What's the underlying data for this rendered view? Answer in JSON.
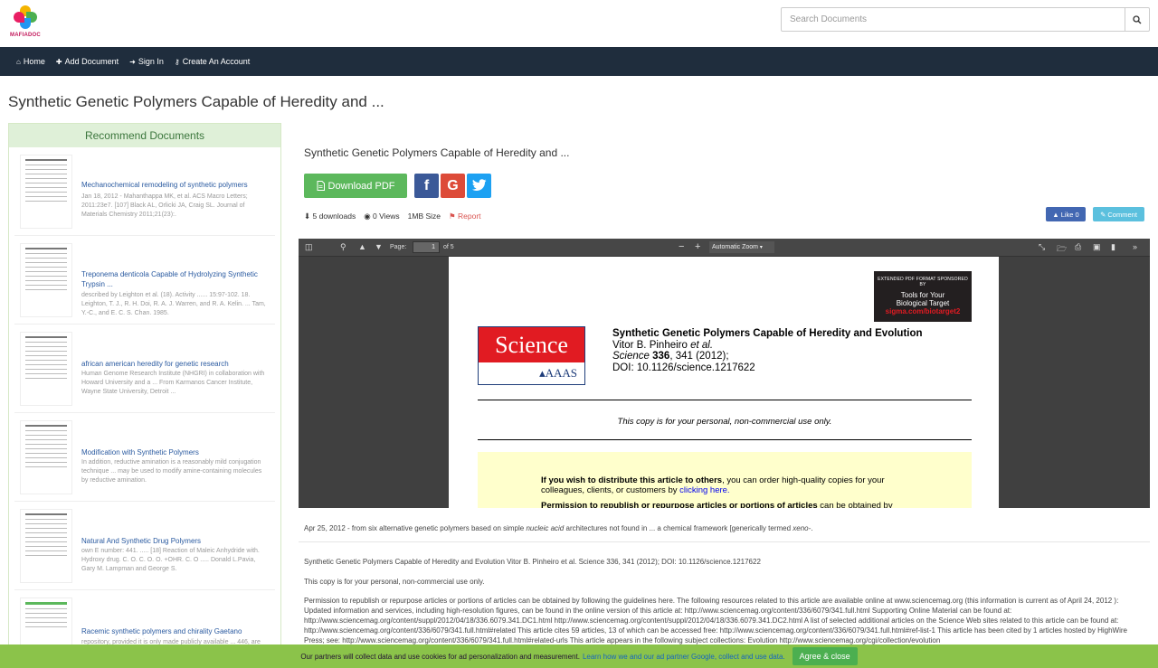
{
  "brand": {
    "name": "MAFIADOC"
  },
  "search": {
    "placeholder": "Search Documents"
  },
  "nav": {
    "items": [
      {
        "label": "Home",
        "icon": "home-icon"
      },
      {
        "label": "Add Document",
        "icon": "plus-icon"
      },
      {
        "label": "Sign In",
        "icon": "sign-in-icon"
      },
      {
        "label": "Create An Account",
        "icon": "key-icon"
      }
    ]
  },
  "page": {
    "title": "Synthetic Genetic Polymers Capable of Heredity and ..."
  },
  "sidebar": {
    "heading": "Recommend Documents",
    "items": [
      {
        "title": "Mechanochemical remodeling of synthetic polymers",
        "desc": "Jan 18, 2012 - Mahanthappa MK, et al. ACS Macro Letters; 2011:23e7. [107] Black AL, Orlicki JA, Craig SL. Journal of Materials Chemistry 2011;21(23):."
      },
      {
        "title": "Treponema denticola Capable of Hydrolyzing Synthetic Trypsin ...",
        "desc": "described by Leighton et al. (18). Activity ...... 15:97-102. 18. Leighton, T. J., R. H. Doi, R. A. J. Warren, and R. A. Kelin. ... Tam, Y.-C., and E. C. S. Chan. 1985."
      },
      {
        "title": "african american heredity for genetic research",
        "desc": "Human Genome Research Institute (NHGRI) in collaboration with Howard University and a ... From Karmanos Cancer Institute, Wayne State University, Detroit ..."
      },
      {
        "title": "Modification with Synthetic Polymers",
        "desc": "In addition, reductive amination is a reasonably mild conjugation technique ... may be used to modify amine-containing molecules by reductive amination."
      },
      {
        "title": "Natural And Synthetic Drug Polymers",
        "desc": "own E number: 441. ..... [18] Reaction of Maleic Anhydride with. Hydroxy drug. C. O. C. O. O. +OHR. C. O ..... Donald L.Pavia, Gary M. Lampman and George S."
      },
      {
        "title": "Racemic synthetic polymers and chirality Gaetano",
        "desc": "repository, provided it is only made publicly available ... 446, are related to possible formation of long ordered ... Of course, these chiral catalysts are ... bidden), which in turn"
      }
    ]
  },
  "document": {
    "title": "Synthetic Genetic Polymers Capable of Heredity and ...",
    "download_label": "Download PDF",
    "downloads": "5 downloads",
    "views": "0 Views",
    "size": "1MB Size",
    "report": "Report",
    "like_label": "Like 0",
    "comment_label": "Comment"
  },
  "viewer": {
    "page_label": "Page:",
    "page_current": "1",
    "page_total": "of 5",
    "zoom": "Automatic Zoom",
    "sponsor_line1": "EXTENDED PDF FORMAT SPONSORED BY",
    "sponsor_line2": "Tools for Your",
    "sponsor_line3": "Biological Target",
    "sponsor_link": "sigma.com/biotarget2",
    "logo_top": "Science",
    "logo_bottom": "AAAS",
    "article_title": "Synthetic Genetic Polymers Capable of Heredity and Evolution",
    "article_authors": "Vitor B. Pinheiro ",
    "article_etal": "et al.",
    "article_journal": "Science",
    "article_vol": " 336",
    "article_pages": ", 341 (2012);",
    "article_doi": "DOI: 10.1126/science.1217622",
    "copy_note": "This copy is for your personal, non-commercial use only.",
    "dist_bold": "If you wish to distribute this article to others",
    "dist_rest": ", you can order high-quality copies for your",
    "dist_line2": "colleagues, clients, or customers by ",
    "dist_link": "clicking here.",
    "perm_bold": "Permission to republish or repurpose articles or portions of articles",
    "perm_rest": " can be obtained by",
    "side_num": "12"
  },
  "excerpt": {
    "pre": "Apr 25, 2012 - from six alternative genetic polymers based on simple ",
    "em1": "nucleic acid",
    "mid": " architectures not found in ... a chemical framework [generically termed ",
    "em2": "xeno-",
    "post": "."
  },
  "body": {
    "p1": "Synthetic Genetic Polymers Capable of Heredity and Evolution Vitor B. Pinheiro et al. Science 336, 341 (2012); DOI: 10.1126/science.1217622",
    "p2": "This copy is for your personal, non-commercial use only.",
    "p3": "Permission to republish or repurpose articles or portions of articles can be obtained by following the guidelines here. The following resources related to this article are available online at www.sciencemag.org (this information is current as of April 24, 2012 ): Updated information and services, including high-resolution figures, can be found in the online version of this article at: http://www.sciencemag.org/content/336/6079/341.full.html Supporting Online Material can be found at: http://www.sciencemag.org/content/suppl/2012/04/18/336.6079.341.DC1.html http://www.sciencemag.org/content/suppl/2012/04/18/336.6079.341.DC2.html A list of selected additional articles on the Science Web sites related to this article can be found at: http://www.sciencemag.org/content/336/6079/341.full.html#related This article cites 59 articles, 13 of which can be accessed free: http://www.sciencemag.org/content/336/6079/341.full.html#ref-list-1 This article has been cited by 1 articles hosted by HighWire Press; see: http://www.sciencemag.org/content/336/6079/341.full.html#related-urls This article appears in the following subject collections: Evolution http://www.sciencemag.org/cgi/collection/evolution"
  },
  "cookie": {
    "text": "Our partners will collect data and use cookies for ad personalization and measurement.",
    "link": "Learn how we and our ad partner Google, collect and use data.",
    "button": "Agree & close"
  }
}
